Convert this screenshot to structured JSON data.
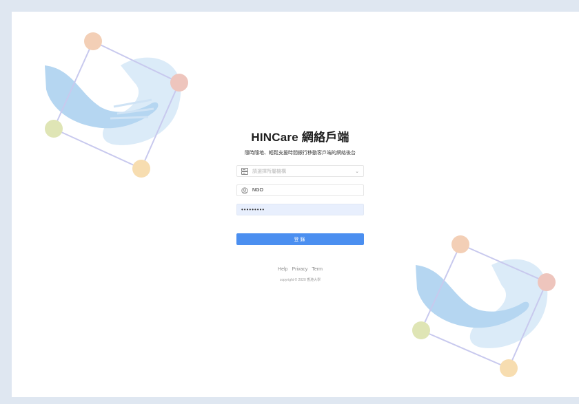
{
  "login": {
    "title": "HINCare 網絡戶端",
    "subtitle": "隨時隨地、輕鬆支援時間銀行移動客戶端的網絡後台",
    "organization": {
      "placeholder": "請選擇所屬機構",
      "icon": "server-icon"
    },
    "username": {
      "value": "NGO",
      "icon": "user-icon"
    },
    "password": {
      "value": "•••••••••",
      "icon": "lock-icon"
    },
    "submit_label": "登錄"
  },
  "footer": {
    "links": [
      "Help",
      "Privacy",
      "Term"
    ],
    "copyright": "copyright © 2020 香港大學"
  },
  "colors": {
    "background": "#dfe7f1",
    "primary": "#4b8ff0",
    "autofill": "#e8effd"
  }
}
